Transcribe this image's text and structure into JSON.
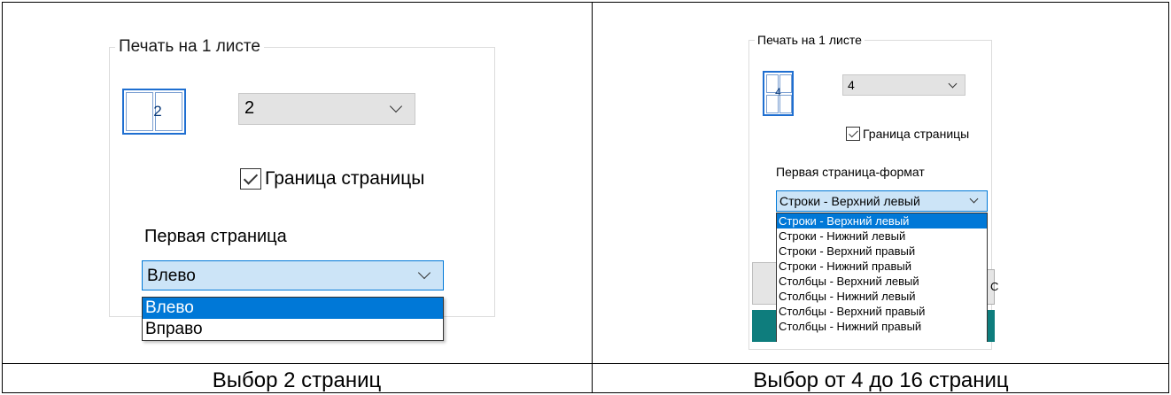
{
  "left_panel": {
    "group_title": "Печать на 1 листе",
    "icon_number": "2",
    "pages_combo_value": "2",
    "border_checkbox_label": "Граница страницы",
    "border_checked": true,
    "first_page_label": "Первая страница",
    "first_page_selected": "Влево",
    "first_page_options": [
      "Влево",
      "Вправо"
    ],
    "caption": "Выбор 2 страниц"
  },
  "right_panel": {
    "group_title": "Печать на 1 листе",
    "icon_number": "4",
    "pages_combo_value": "4",
    "border_checkbox_label": "Граница страницы",
    "border_checked": true,
    "first_page_label": "Первая страница-формат",
    "first_page_selected": "Строки - Верхний левый",
    "first_page_options": [
      "Строки - Верхний левый",
      "Строки - Нижний левый",
      "Строки - Верхний правый",
      "Строки - Нижний правый",
      "Столбцы - Верхний левый",
      "Столбцы - Нижний левый",
      "Столбцы - Верхний правый",
      "Столбцы - Нижний правый"
    ],
    "background_button_letter": "С",
    "caption": "Выбор от 4 до 16 страниц"
  },
  "colors": {
    "accent": "#0078d7",
    "selection_bg": "#cce4f7",
    "combo_bg": "#e3e3e3",
    "teal_bg": "#0e7d7d"
  }
}
